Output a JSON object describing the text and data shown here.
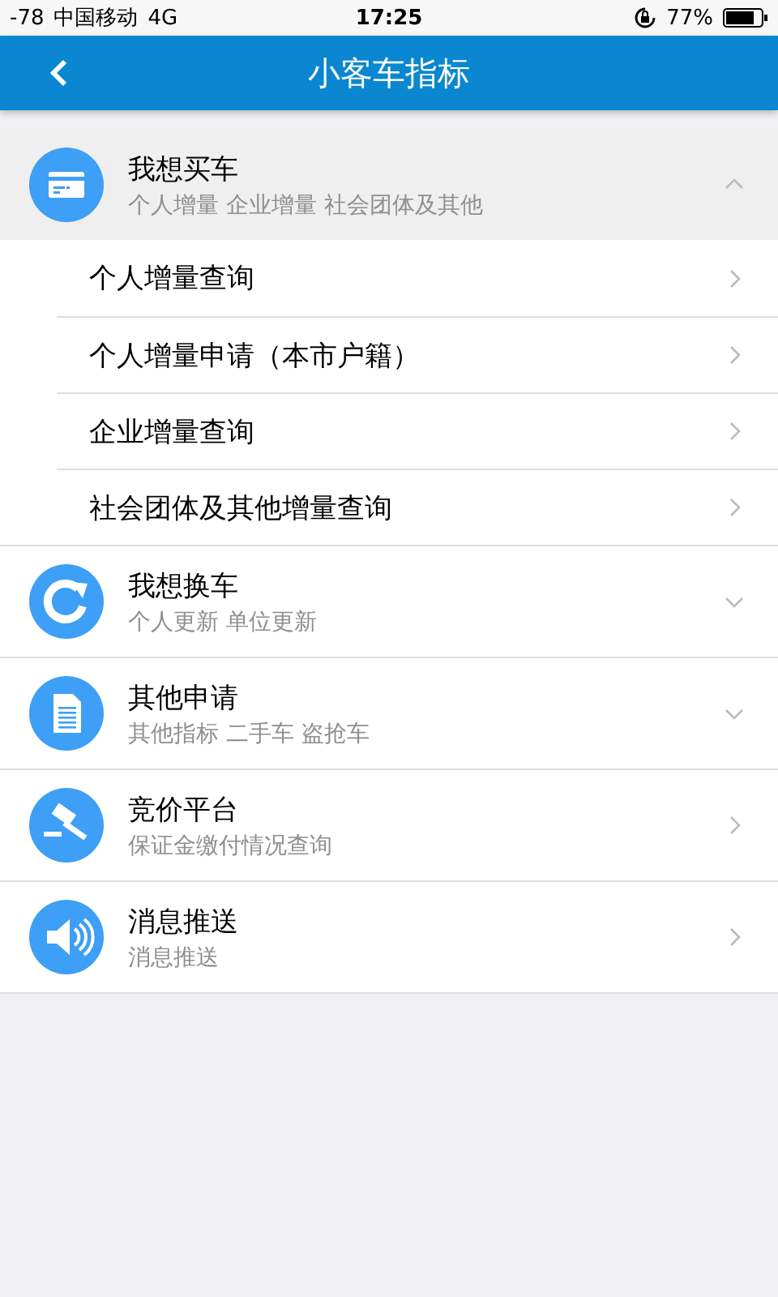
{
  "status_bar": {
    "signal": "-78",
    "carrier": "中国移动",
    "network": "4G",
    "time": "17:25",
    "battery": "77%"
  },
  "nav_bar": {
    "title": "小客车指标"
  },
  "sections": [
    {
      "kind": "expandable",
      "title": "我想买车",
      "subtitle": "个人增量 企业增量 社会团体及其他",
      "expanded": true,
      "children": [
        {
          "label": "个人增量查询"
        },
        {
          "label": "个人增量申请（本市户籍）"
        },
        {
          "label": "企业增量查询"
        },
        {
          "label": "社会团体及其他增量查询"
        }
      ]
    },
    {
      "kind": "expandable",
      "title": "我想换车",
      "subtitle": "个人更新 单位更新",
      "expanded": false
    },
    {
      "kind": "expandable",
      "title": "其他申请",
      "subtitle": "其他指标 二手车 盗抢车",
      "expanded": false
    },
    {
      "kind": "link",
      "title": "竞价平台",
      "subtitle": "保证金缴付情况查询"
    },
    {
      "kind": "link",
      "title": "消息推送",
      "subtitle": "消息推送"
    }
  ]
}
